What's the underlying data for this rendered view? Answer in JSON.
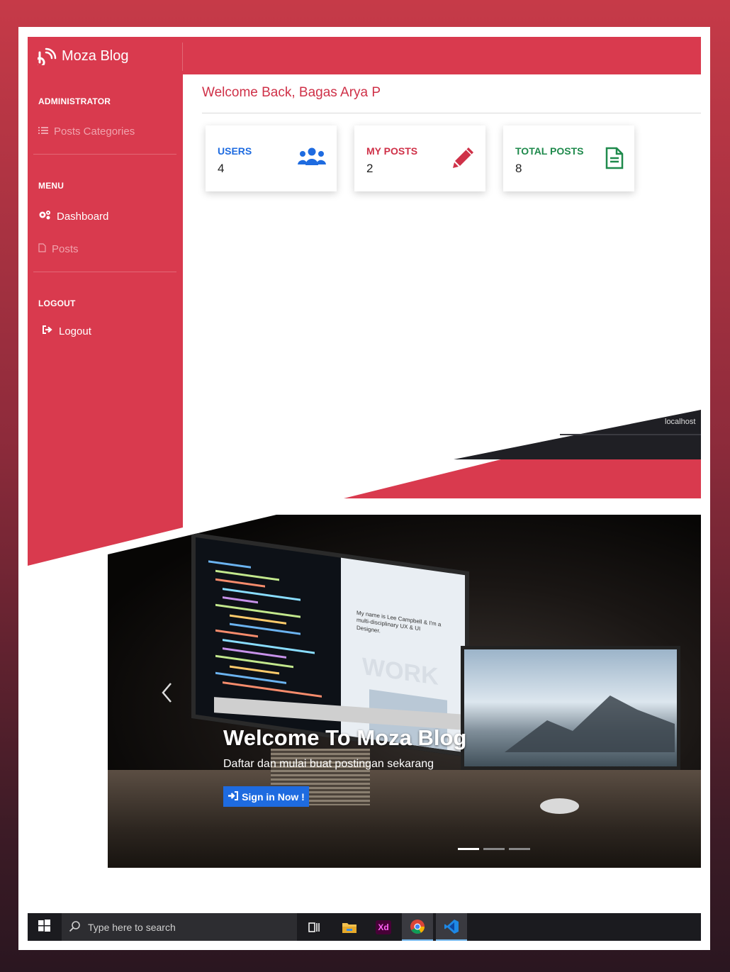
{
  "brand": {
    "name": "Moza Blog",
    "icon": "brand-logo-icon"
  },
  "sidebar": {
    "sections": [
      {
        "heading": "ADMINISTRATOR",
        "items": [
          {
            "label": "Posts Categories",
            "icon": "list-icon"
          }
        ]
      },
      {
        "heading": "MENU",
        "items": [
          {
            "label": "Dashboard",
            "icon": "gears-icon"
          },
          {
            "label": "Posts",
            "icon": "file-icon"
          }
        ]
      },
      {
        "heading": "LOGOUT",
        "items": [
          {
            "label": "Logout",
            "icon": "sign-out-icon"
          }
        ]
      }
    ]
  },
  "main": {
    "welcome": "Welcome Back, Bagas Arya P",
    "cards": [
      {
        "label": "USERS",
        "value": "4",
        "icon": "users-icon",
        "color": "#1e6be0"
      },
      {
        "label": "MY POSTS",
        "value": "2",
        "icon": "pencil-icon",
        "color": "#cf3148"
      },
      {
        "label": "TOTAL POSTS",
        "value": "8",
        "icon": "document-icon",
        "color": "#1f8a4c"
      }
    ]
  },
  "browser_overlay": {
    "tab_text": "localhost"
  },
  "hero": {
    "title": "Welcome To Moza Blog",
    "subtitle": "Daftar dan mulai buat postingan sekarang",
    "button_label": "Sign in Now !",
    "screen_text": "My name is Lee Campbell & I'm a multi-disciplinary UX & UI Designer.",
    "screen_heading": "WORK",
    "indicators": 3,
    "active_indicator": 0
  },
  "taskbar": {
    "search_placeholder": "Type here to search",
    "apps": [
      "task-view-icon",
      "file-explorer-icon",
      "adobe-xd-icon",
      "chrome-icon",
      "vscode-icon"
    ],
    "xd_label": "Xd"
  },
  "colors": {
    "primary_red": "#d93a4e",
    "accent_blue": "#1e6be0",
    "accent_green": "#1f8a4c"
  }
}
